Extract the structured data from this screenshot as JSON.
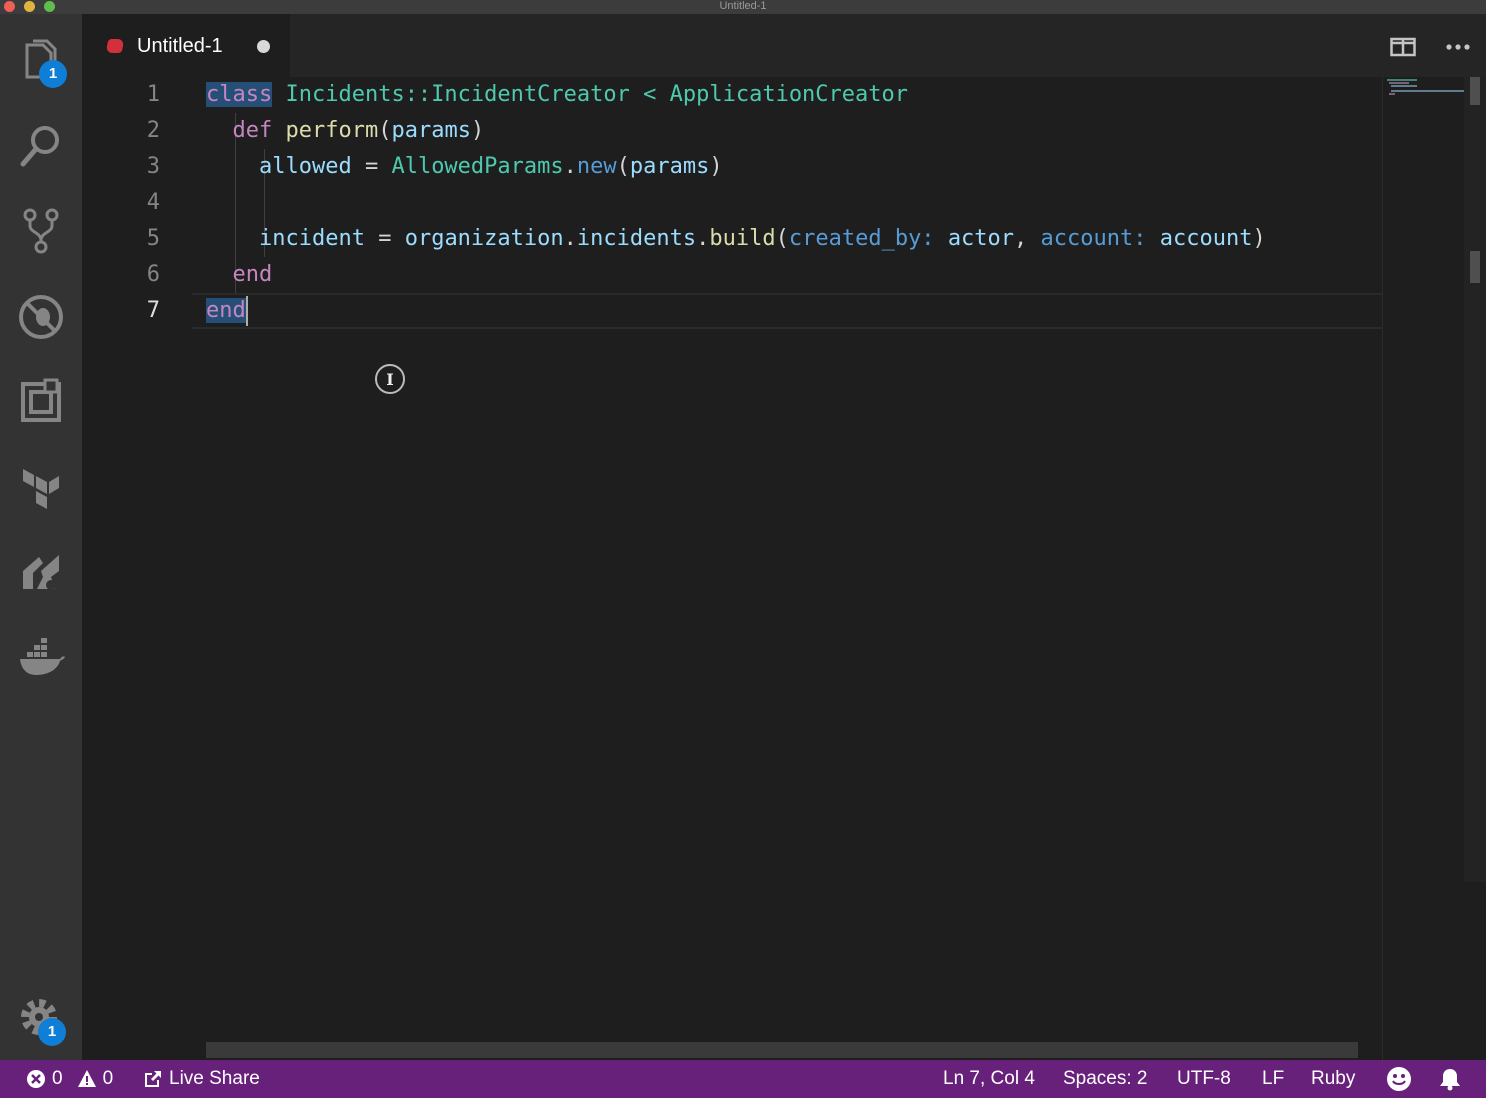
{
  "window": {
    "title": "Untitled-1"
  },
  "activity_bar": {
    "items": [
      {
        "icon": "explorer-icon",
        "badge": "1"
      },
      {
        "icon": "search-icon"
      },
      {
        "icon": "source-control-icon"
      },
      {
        "icon": "debug-icon"
      },
      {
        "icon": "extensions-icon"
      },
      {
        "icon": "terraform-icon"
      },
      {
        "icon": "live-share-icon"
      },
      {
        "icon": "docker-icon"
      }
    ],
    "settings": {
      "icon": "gear-icon",
      "badge": "1"
    }
  },
  "tabs": [
    {
      "label": "Untitled-1",
      "icon": "ruby-file-icon",
      "dirty": true
    }
  ],
  "editor": {
    "language": "Ruby",
    "line_numbers": [
      "1",
      "2",
      "3",
      "4",
      "5",
      "6",
      "7"
    ],
    "active_line": 7,
    "lines": [
      [
        {
          "t": "class",
          "c": "kw-sel"
        },
        {
          "t": " ",
          "c": "plain"
        },
        {
          "t": "Incidents::IncidentCreator",
          "c": "cls"
        },
        {
          "t": " < ",
          "c": "cls"
        },
        {
          "t": "ApplicationCreator",
          "c": "cls"
        }
      ],
      [
        {
          "t": "  ",
          "c": "plain"
        },
        {
          "t": "def",
          "c": "kw"
        },
        {
          "t": " ",
          "c": "plain"
        },
        {
          "t": "perform",
          "c": "fn"
        },
        {
          "t": "(",
          "c": "plain"
        },
        {
          "t": "params",
          "c": "var"
        },
        {
          "t": ")",
          "c": "plain"
        }
      ],
      [
        {
          "t": "    ",
          "c": "plain"
        },
        {
          "t": "allowed",
          "c": "var"
        },
        {
          "t": " = ",
          "c": "plain"
        },
        {
          "t": "AllowedParams",
          "c": "const"
        },
        {
          "t": ".",
          "c": "plain"
        },
        {
          "t": "new",
          "c": "meth"
        },
        {
          "t": "(",
          "c": "plain"
        },
        {
          "t": "params",
          "c": "var"
        },
        {
          "t": ")",
          "c": "plain"
        }
      ],
      [
        {
          "t": "",
          "c": "plain"
        }
      ],
      [
        {
          "t": "    ",
          "c": "plain"
        },
        {
          "t": "incident",
          "c": "var"
        },
        {
          "t": " = ",
          "c": "plain"
        },
        {
          "t": "organization",
          "c": "var"
        },
        {
          "t": ".",
          "c": "plain"
        },
        {
          "t": "incidents",
          "c": "var"
        },
        {
          "t": ".",
          "c": "plain"
        },
        {
          "t": "build",
          "c": "fn"
        },
        {
          "t": "(",
          "c": "plain"
        },
        {
          "t": "created_by:",
          "c": "sym"
        },
        {
          "t": " ",
          "c": "plain"
        },
        {
          "t": "actor",
          "c": "var"
        },
        {
          "t": ", ",
          "c": "plain"
        },
        {
          "t": "account:",
          "c": "sym"
        },
        {
          "t": " ",
          "c": "plain"
        },
        {
          "t": "account",
          "c": "var"
        },
        {
          "t": ")",
          "c": "plain"
        }
      ],
      [
        {
          "t": "  ",
          "c": "plain"
        },
        {
          "t": "end",
          "c": "kw"
        }
      ],
      [
        {
          "t": "end",
          "c": "kw-sel"
        }
      ]
    ]
  },
  "status_bar": {
    "errors": "0",
    "warnings": "0",
    "live_share": "Live Share",
    "position": "Ln 7, Col 4",
    "spaces": "Spaces: 2",
    "encoding": "UTF-8",
    "eol": "LF",
    "language": "Ruby"
  },
  "colors": {
    "status_bar": "#68217a",
    "badge": "#0e7ed6",
    "editor_bg": "#1e1e1e",
    "activity_bar_bg": "#333333"
  }
}
